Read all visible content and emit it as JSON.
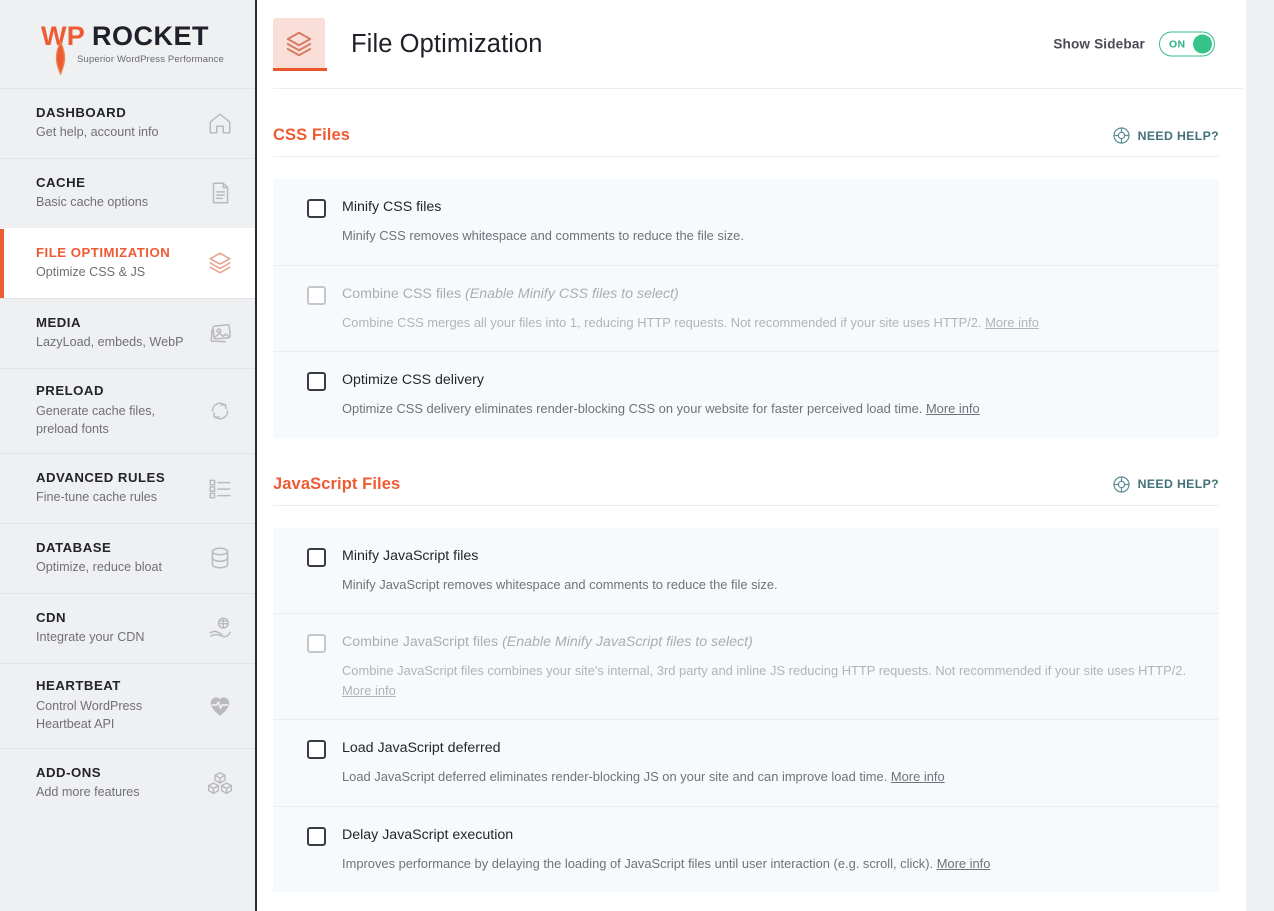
{
  "brand": {
    "name_wp": "WP",
    "name_rocket": "ROCKET",
    "tagline": "Superior WordPress Performance",
    "accent": "#ee5b33"
  },
  "sidebar": {
    "items": [
      {
        "title": "DASHBOARD",
        "subtitle": "Get help, account info",
        "icon": "home-icon",
        "active": false
      },
      {
        "title": "CACHE",
        "subtitle": "Basic cache options",
        "icon": "document-icon",
        "active": false
      },
      {
        "title": "FILE OPTIMIZATION",
        "subtitle": "Optimize CSS & JS",
        "icon": "layers-icon",
        "active": true
      },
      {
        "title": "MEDIA",
        "subtitle": "LazyLoad, embeds, WebP",
        "icon": "photos-icon",
        "active": false
      },
      {
        "title": "PRELOAD",
        "subtitle": "Generate cache files, preload fonts",
        "icon": "refresh-icon",
        "active": false
      },
      {
        "title": "ADVANCED RULES",
        "subtitle": "Fine-tune cache rules",
        "icon": "list-checkbox-icon",
        "active": false
      },
      {
        "title": "DATABASE",
        "subtitle": "Optimize, reduce bloat",
        "icon": "database-icon",
        "active": false
      },
      {
        "title": "CDN",
        "subtitle": "Integrate your CDN",
        "icon": "cloud-hand-icon",
        "active": false
      },
      {
        "title": "HEARTBEAT",
        "subtitle": "Control WordPress Heartbeat API",
        "icon": "heart-pulse-icon",
        "active": false
      },
      {
        "title": "ADD-ONS",
        "subtitle": "Add more features",
        "icon": "blocks-icon",
        "active": false
      }
    ]
  },
  "header": {
    "title": "File Optimization",
    "icon": "layers-icon",
    "show_sidebar_label": "Show Sidebar",
    "toggle_state": "ON",
    "toggle_on_color": "#34c487"
  },
  "need_help": {
    "label": "NEED HELP?",
    "icon": "lifebuoy-icon"
  },
  "sections": [
    {
      "title": "CSS Files",
      "options": [
        {
          "label": "Minify CSS files",
          "hint": "",
          "description": "Minify CSS removes whitespace and comments to reduce the file size.",
          "more_info": "",
          "checked": false,
          "disabled": false
        },
        {
          "label": "Combine CSS files",
          "hint": "(Enable Minify CSS files to select)",
          "description": "Combine CSS merges all your files into 1, reducing HTTP requests. Not recommended if your site uses HTTP/2.",
          "more_info": "More info",
          "checked": false,
          "disabled": true
        },
        {
          "label": "Optimize CSS delivery",
          "hint": "",
          "description": "Optimize CSS delivery eliminates render-blocking CSS on your website for faster perceived load time.",
          "more_info": "More info",
          "checked": false,
          "disabled": false
        }
      ]
    },
    {
      "title": "JavaScript Files",
      "options": [
        {
          "label": "Minify JavaScript files",
          "hint": "",
          "description": "Minify JavaScript removes whitespace and comments to reduce the file size.",
          "more_info": "",
          "checked": false,
          "disabled": false
        },
        {
          "label": "Combine JavaScript files",
          "hint": "(Enable Minify JavaScript files to select)",
          "description": "Combine JavaScript files combines your site's internal, 3rd party and inline JS reducing HTTP requests. Not recommended if your site uses HTTP/2.",
          "more_info": "More info",
          "checked": false,
          "disabled": true
        },
        {
          "label": "Load JavaScript deferred",
          "hint": "",
          "description": "Load JavaScript deferred eliminates render-blocking JS on your site and can improve load time.",
          "more_info": "More info",
          "checked": false,
          "disabled": false
        },
        {
          "label": "Delay JavaScript execution",
          "hint": "",
          "description": "Improves performance by delaying the loading of JavaScript files until user interaction (e.g. scroll, click).",
          "more_info": "More info",
          "checked": false,
          "disabled": false
        }
      ]
    }
  ]
}
